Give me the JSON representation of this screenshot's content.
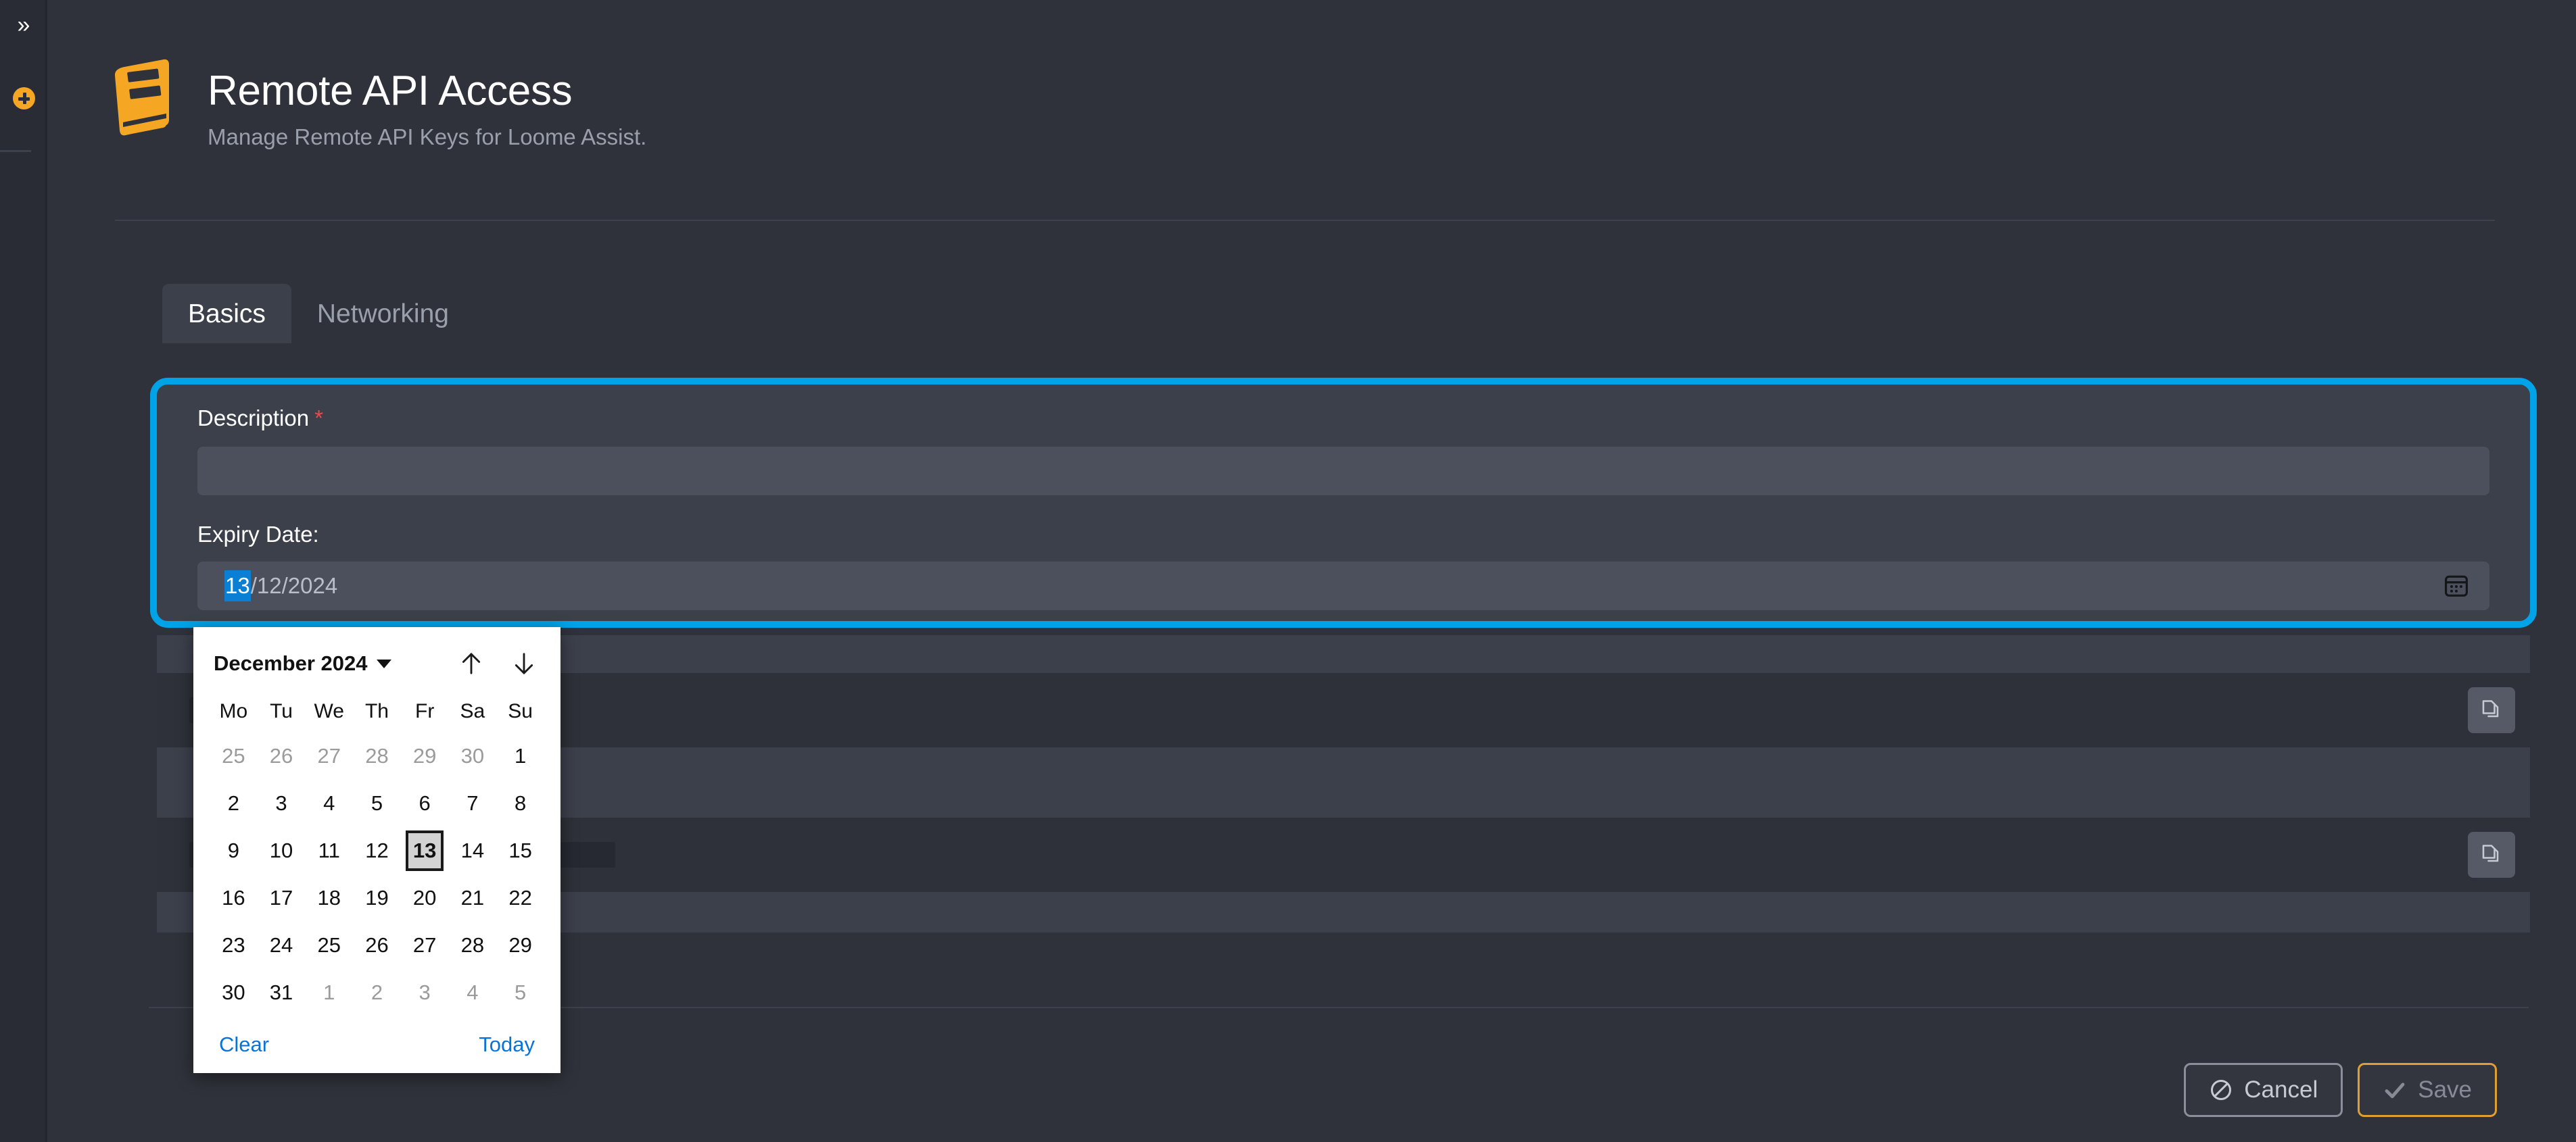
{
  "rail": {
    "expand_icon": "double-chevron-right-icon",
    "expand_glyph": "»",
    "add_icon": "plus-circle-icon"
  },
  "header": {
    "icon": "book-icon",
    "title": "Remote API Access",
    "subtitle": "Manage Remote API Keys for Loome Assist."
  },
  "tabs": [
    {
      "label": "Basics",
      "active": true
    },
    {
      "label": "Networking",
      "active": false
    }
  ],
  "form": {
    "description": {
      "label": "Description",
      "required_marker": "*",
      "value": "",
      "placeholder": ""
    },
    "expiry": {
      "label": "Expiry Date:",
      "selected_segment": "13",
      "rest": "/12/2024",
      "full_value": "13/12/2024",
      "calendar_icon": "calendar-icon"
    },
    "focus_outline_color": "#00a2e8"
  },
  "lower_rows": {
    "copy_icon": "copy-icon",
    "rows": [
      {
        "redacted": true,
        "redact_width": 200
      },
      {
        "redacted": true,
        "redact_width": 630
      }
    ]
  },
  "datepicker": {
    "month_year": "December 2024",
    "dropdown_icon": "chevron-down-icon",
    "prev_icon": "arrow-up-icon",
    "next_icon": "arrow-down-icon",
    "weekdays": [
      "Mo",
      "Tu",
      "We",
      "Th",
      "Fr",
      "Sa",
      "Su"
    ],
    "weeks": [
      [
        {
          "d": "25",
          "muted": true
        },
        {
          "d": "26",
          "muted": true
        },
        {
          "d": "27",
          "muted": true
        },
        {
          "d": "28",
          "muted": true
        },
        {
          "d": "29",
          "muted": true
        },
        {
          "d": "30",
          "muted": true
        },
        {
          "d": "1",
          "muted": false
        }
      ],
      [
        {
          "d": "2",
          "muted": false
        },
        {
          "d": "3",
          "muted": false
        },
        {
          "d": "4",
          "muted": false
        },
        {
          "d": "5",
          "muted": false
        },
        {
          "d": "6",
          "muted": false
        },
        {
          "d": "7",
          "muted": false
        },
        {
          "d": "8",
          "muted": false
        }
      ],
      [
        {
          "d": "9",
          "muted": false
        },
        {
          "d": "10",
          "muted": false
        },
        {
          "d": "11",
          "muted": false
        },
        {
          "d": "12",
          "muted": false
        },
        {
          "d": "13",
          "muted": false,
          "selected": true
        },
        {
          "d": "14",
          "muted": false
        },
        {
          "d": "15",
          "muted": false
        }
      ],
      [
        {
          "d": "16",
          "muted": false
        },
        {
          "d": "17",
          "muted": false
        },
        {
          "d": "18",
          "muted": false
        },
        {
          "d": "19",
          "muted": false
        },
        {
          "d": "20",
          "muted": false
        },
        {
          "d": "21",
          "muted": false
        },
        {
          "d": "22",
          "muted": false
        }
      ],
      [
        {
          "d": "23",
          "muted": false
        },
        {
          "d": "24",
          "muted": false
        },
        {
          "d": "25",
          "muted": false
        },
        {
          "d": "26",
          "muted": false
        },
        {
          "d": "27",
          "muted": false
        },
        {
          "d": "28",
          "muted": false
        },
        {
          "d": "29",
          "muted": false
        }
      ],
      [
        {
          "d": "30",
          "muted": false
        },
        {
          "d": "31",
          "muted": false
        },
        {
          "d": "1",
          "muted": true
        },
        {
          "d": "2",
          "muted": true
        },
        {
          "d": "3",
          "muted": true
        },
        {
          "d": "4",
          "muted": true
        },
        {
          "d": "5",
          "muted": true
        }
      ]
    ],
    "clear_label": "Clear",
    "today_label": "Today",
    "link_color": "#0a74d6",
    "selected_day": "13"
  },
  "footer": {
    "cancel_label": "Cancel",
    "cancel_icon": "ban-icon",
    "save_label": "Save",
    "save_icon": "check-icon",
    "save_border_color": "#e0a030"
  },
  "colors": {
    "page_bg": "#2f323a",
    "panel_bg": "#3c404b",
    "input_bg": "#4c505c",
    "accent_blue": "#00a2e8",
    "brand_orange": "#f5a623",
    "required_red": "#e84b4b"
  }
}
